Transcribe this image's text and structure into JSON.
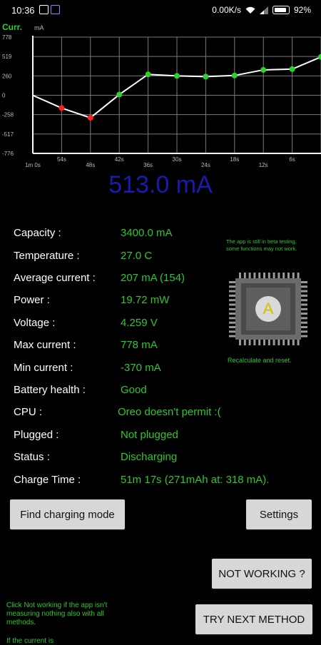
{
  "status_bar": {
    "time": "10:36",
    "network_speed": "0.00K/s",
    "battery": "92%"
  },
  "chart_data": {
    "type": "line",
    "title": "Curr.",
    "unit_label": "mA",
    "ylim": [
      -776,
      778
    ],
    "y_ticks": [
      "778",
      "519",
      "260",
      "0",
      "-258",
      "-517",
      "-776"
    ],
    "x_ticks": [
      "1m 0s",
      "54s",
      "48s",
      "42s",
      "36s",
      "30s",
      "24s",
      "18s",
      "12s",
      "6s"
    ],
    "grid": true,
    "points": [
      {
        "x": 0,
        "y": 0,
        "color": "#ffffff"
      },
      {
        "x": 1,
        "y": -170,
        "color": "#ff2020"
      },
      {
        "x": 2,
        "y": -300,
        "color": "#ff2020"
      },
      {
        "x": 3,
        "y": 10,
        "color": "#2ed02e"
      },
      {
        "x": 4,
        "y": 280,
        "color": "#2ed02e"
      },
      {
        "x": 5,
        "y": 260,
        "color": "#2ed02e"
      },
      {
        "x": 6,
        "y": 250,
        "color": "#2ed02e"
      },
      {
        "x": 7,
        "y": 265,
        "color": "#2ed02e"
      },
      {
        "x": 8,
        "y": 340,
        "color": "#2ed02e"
      },
      {
        "x": 9,
        "y": 350,
        "color": "#2ed02e"
      },
      {
        "x": 10,
        "y": 513,
        "color": "#2ed02e"
      }
    ],
    "colors": {
      "title": "#2ed02e",
      "line": "#ffffff",
      "grid": "#7a7a7a",
      "tick_labels": "#bbbbbb"
    }
  },
  "readout": "513.0 mA",
  "info": [
    {
      "label": "Capacity :",
      "value": "3400.0 mA"
    },
    {
      "label": "Temperature :",
      "value": "27.0 C"
    },
    {
      "label": "Average current :",
      "value": "207 mA (154)"
    },
    {
      "label": "Power :",
      "value": "19.72 mW"
    },
    {
      "label": "Voltage :",
      "value": "4.259 V"
    },
    {
      "label": "Max current :",
      "value": "778 mA"
    },
    {
      "label": "Min current :",
      "value": "-370 mA"
    },
    {
      "label": "Battery health :",
      "value": "Good"
    },
    {
      "label": "CPU :",
      "value": "Oreo doesn't permit :("
    },
    {
      "label": "Plugged :",
      "value": "Not plugged"
    },
    {
      "label": "Status :",
      "value": "Discharging"
    },
    {
      "label": "Charge Time :",
      "value": "51m 17s (271mAh at: 318 mA)."
    }
  ],
  "beta_note": "The app is still in beta testing, some functions may not work.",
  "chip_letter": "A",
  "recalculate": "Recalculate and reset.",
  "buttons": {
    "find_charging_mode": "Find charging mode",
    "settings": "Settings",
    "not_working": "NOT WORKING ?",
    "try_next": "TRY NEXT METHOD"
  },
  "hint": "Click Not working if the app isn't measuring nothing also with all methods.",
  "hint_cut": "If the current is"
}
